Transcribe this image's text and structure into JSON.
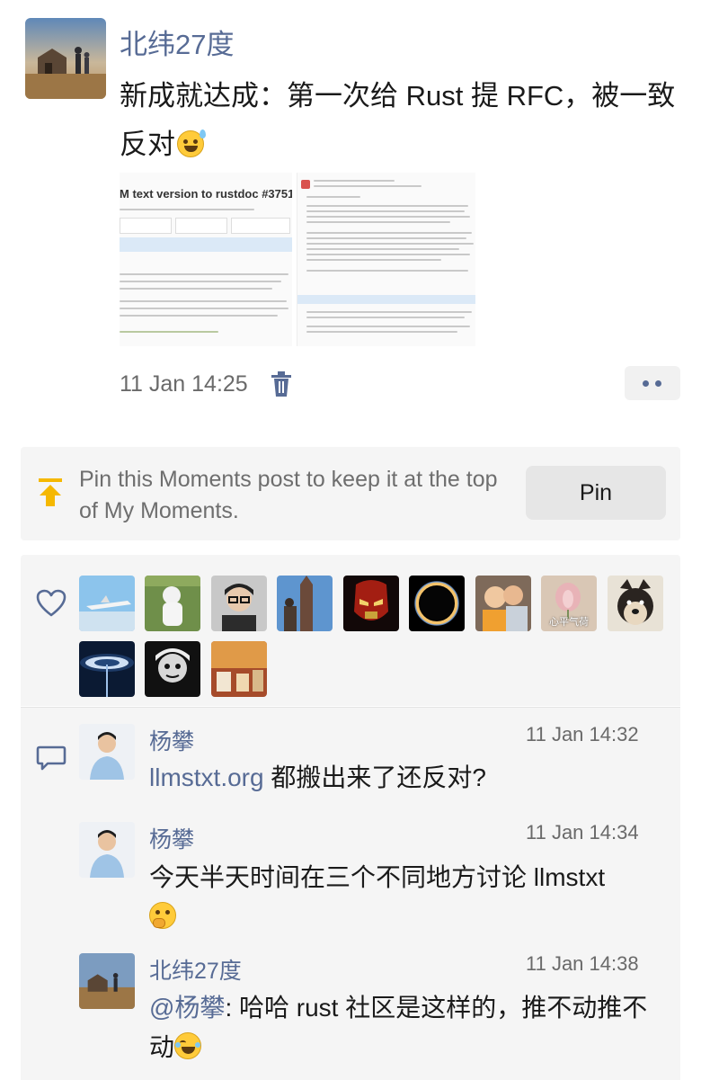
{
  "post": {
    "author": "北纬27度",
    "text": "新成就达成：第一次给 Rust 提 RFC，被一致反对",
    "emoji": "sweat-smile-emoji",
    "timestamp": "11 Jan 14:25",
    "screenshot_title": "M text version to rustdoc #3751"
  },
  "pin": {
    "text": "Pin this Moments post to keep it at the top of My Moments.",
    "button_label": "Pin"
  },
  "likes": {
    "count_shown": 12,
    "avatar_labels": {
      "lotus": "心平气荷"
    }
  },
  "comments": [
    {
      "name": "杨攀",
      "time": "11 Jan 14:32",
      "link": "llmstxt.org",
      "text": " 都搬出来了还反对?"
    },
    {
      "name": "杨攀",
      "time": "11 Jan 14:34",
      "text": "今天半天时间在三个不同地方讨论 llmstxt"
    },
    {
      "name": "北纬27度",
      "time": "11 Jan 14:38",
      "mention": "@杨攀",
      "text": ": 哈哈 rust 社区是这样的，推不动推不动"
    }
  ],
  "colors": {
    "link": "#576b95",
    "pin_arrow": "#f5b800",
    "panel_bg": "#f5f5f5"
  }
}
